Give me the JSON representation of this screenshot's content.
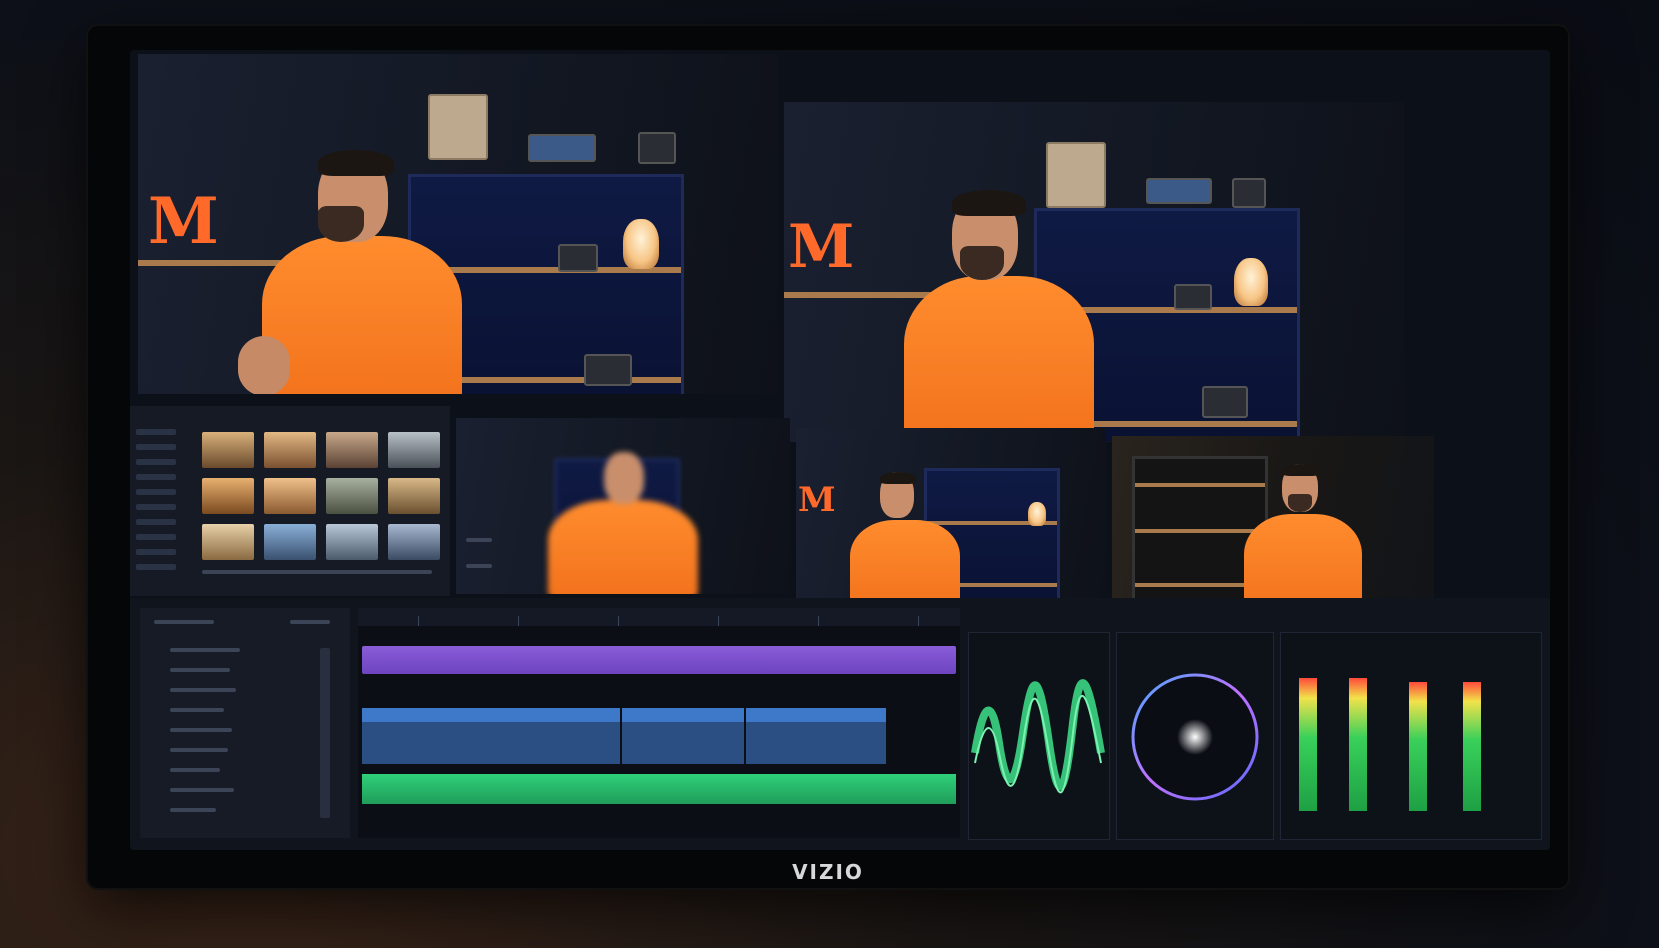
{
  "device": {
    "brand": "VIZIO"
  },
  "viewers": [
    {
      "name": "program-viewer",
      "active": false
    },
    {
      "name": "preview-viewer",
      "active": false
    },
    {
      "name": "camera-1-viewer",
      "active": false
    },
    {
      "name": "camera-2-viewer",
      "active": true
    },
    {
      "name": "camera-3-viewer",
      "active": false
    }
  ],
  "colors": {
    "accent_orange": "#ff6a2b",
    "active_border": "#e53b2f",
    "video_track": "#7a4fcc",
    "clip_blue": "#3d78c9",
    "audio_track": "#2fd07a",
    "scope_trace": "#3ee28a"
  },
  "meters": {
    "levels": [
      0.78,
      0.78,
      0.76,
      0.76
    ]
  }
}
